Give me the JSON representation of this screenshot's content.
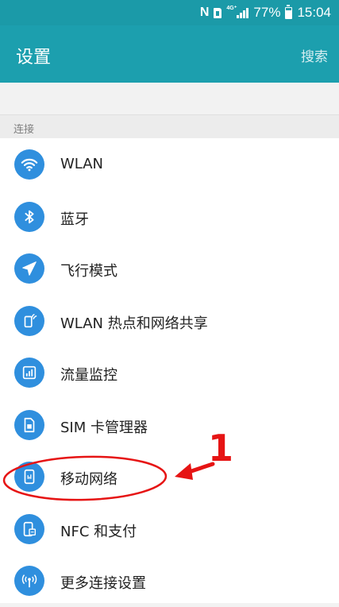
{
  "status_bar": {
    "battery_percent": "77%",
    "battery_level": 0.77,
    "time": "15:04",
    "network_type": "4G⁺",
    "icons": [
      "nfc-icon",
      "sim-icon",
      "signal-icon",
      "battery-icon"
    ]
  },
  "app_bar": {
    "title": "设置",
    "search_label": "搜索"
  },
  "section": {
    "header": "连接"
  },
  "items": [
    {
      "label": "WLAN",
      "icon": "wifi-icon"
    },
    {
      "label": "蓝牙",
      "icon": "bluetooth-icon"
    },
    {
      "label": "飞行模式",
      "icon": "airplane-icon"
    },
    {
      "label": "WLAN 热点和网络共享",
      "icon": "hotspot-icon"
    },
    {
      "label": "流量监控",
      "icon": "data-usage-icon"
    },
    {
      "label": "SIM 卡管理器",
      "icon": "sim-card-icon"
    },
    {
      "label": "移动网络",
      "icon": "mobile-network-icon"
    },
    {
      "label": "NFC 和支付",
      "icon": "nfc-payment-icon"
    },
    {
      "label": "更多连接设置",
      "icon": "more-connections-icon"
    }
  ],
  "annotation": {
    "number": "1"
  },
  "colors": {
    "status_bar": "#1b9aa8",
    "app_bar": "#1c9fae",
    "icon_circle": "#2f8fde",
    "annotation": "#e61414"
  }
}
